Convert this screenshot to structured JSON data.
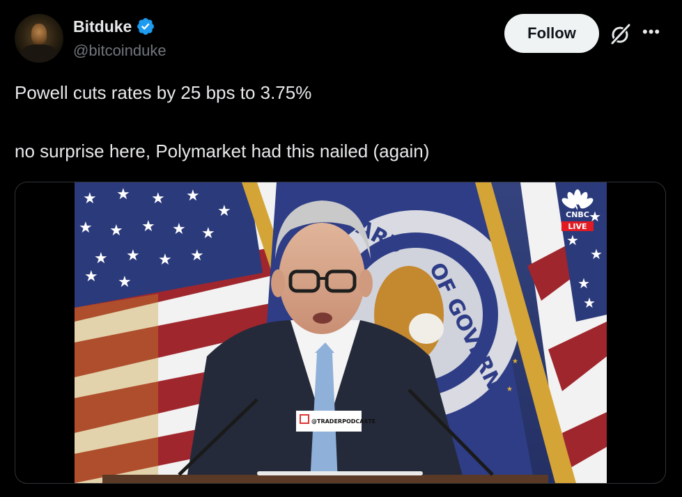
{
  "author": {
    "name": "Bitduke",
    "handle": "@bitcoinduke",
    "verified": true
  },
  "actions": {
    "follow_label": "Follow",
    "grok_icon": "grok-icon",
    "more_label": "•••"
  },
  "tweet": {
    "line1": "Powell cuts rates by 25 bps to 3.75%",
    "line2": "no surprise here, Polymarket had this nailed (again)"
  },
  "video": {
    "network": "CNBC",
    "live_badge": "LIVE",
    "seal_text": "ARD OF GOVERN",
    "watermark": "@TRADERPODCASTE"
  },
  "colors": {
    "verified_blue": "#1d9bf0",
    "follow_bg": "#eff3f4",
    "live_red": "#e21a22",
    "flag_blue": "#2b3a7a",
    "flag_red": "#a0262d",
    "fed_blue": "#2e3d86",
    "gold": "#c89a2a"
  }
}
